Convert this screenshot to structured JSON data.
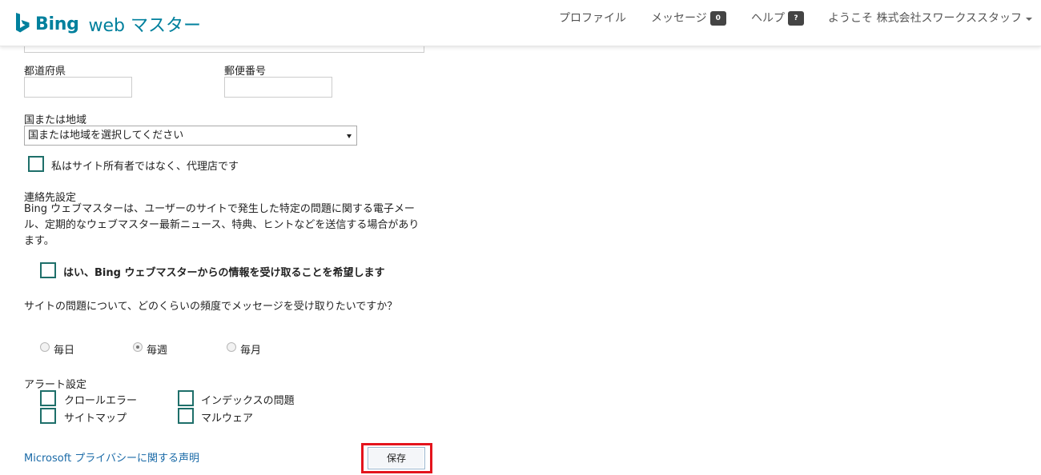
{
  "header": {
    "logo_brand": "Bing",
    "logo_rest": "web マスター",
    "nav": {
      "profile": "プロファイル",
      "messages": "メッセージ",
      "messages_count": "0",
      "help": "ヘルプ",
      "help_badge": "?",
      "welcome": "ようこそ 株式会社スワークススタッフ"
    }
  },
  "form": {
    "prefecture_label": "都道府県",
    "prefecture_value": "",
    "postal_label": "郵便番号",
    "postal_value": "",
    "country_label": "国または地域",
    "country_selected": "国または地域を選択してください",
    "agency_label": "私はサイト所有者ではなく、代理店です",
    "contact_heading": "連絡先設定",
    "contact_desc": "Bing ウェブマスターは、ユーザーのサイトで発生した特定の問題に関する電子メール、定期的なウェブマスター最新ニュース、特典、ヒントなどを送信する場合があります。",
    "optin_label": "はい、Bing ウェブマスターからの情報を受け取ることを希望します",
    "frequency_question": "サイトの問題について、どのくらいの頻度でメッセージを受け取りたいですか？",
    "frequency_options": [
      {
        "label": "毎日",
        "checked": false
      },
      {
        "label": "毎週",
        "checked": true
      },
      {
        "label": "毎月",
        "checked": false
      }
    ],
    "alert_heading": "アラート設定",
    "alerts": {
      "crawl_error": "クロールエラー",
      "index_issue": "インデックスの問題",
      "sitemap": "サイトマップ",
      "malware": "マルウェア"
    },
    "privacy_link": "Microsoft プライバシーに関する声明",
    "save_label": "保存"
  },
  "colors": {
    "brand": "#00809d",
    "checkbox_border": "#1e6f6a",
    "link": "#1a6aa7",
    "highlight": "#e4141d"
  }
}
